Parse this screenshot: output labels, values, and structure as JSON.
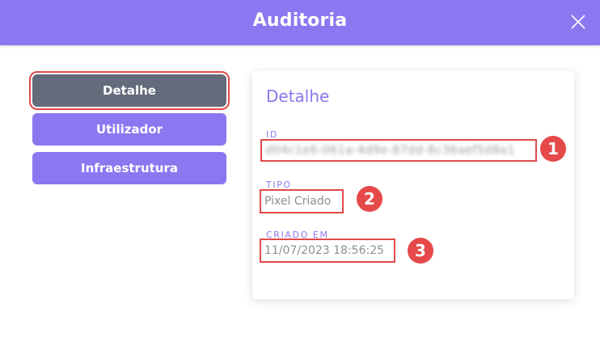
{
  "header": {
    "title": "Auditoria"
  },
  "tabs": [
    {
      "label": "Detalhe"
    },
    {
      "label": "Utilizador"
    },
    {
      "label": "Infraestrutura"
    }
  ],
  "detail": {
    "title": "Detalhe",
    "id": {
      "label": "ID",
      "value": "d04c1e6-061a-4d9e-87dd-8c36aef5d8a1"
    },
    "tipo": {
      "label": "TIPO",
      "value": "Pixel Criado"
    },
    "criado": {
      "label": "CRIADO EM",
      "value": "11/07/2023 18:56:25"
    }
  },
  "callouts": [
    "1",
    "2",
    "3"
  ],
  "colors": {
    "accent": "#8a78f0",
    "active_tab": "#646b7a",
    "highlight": "#e24a4a"
  }
}
